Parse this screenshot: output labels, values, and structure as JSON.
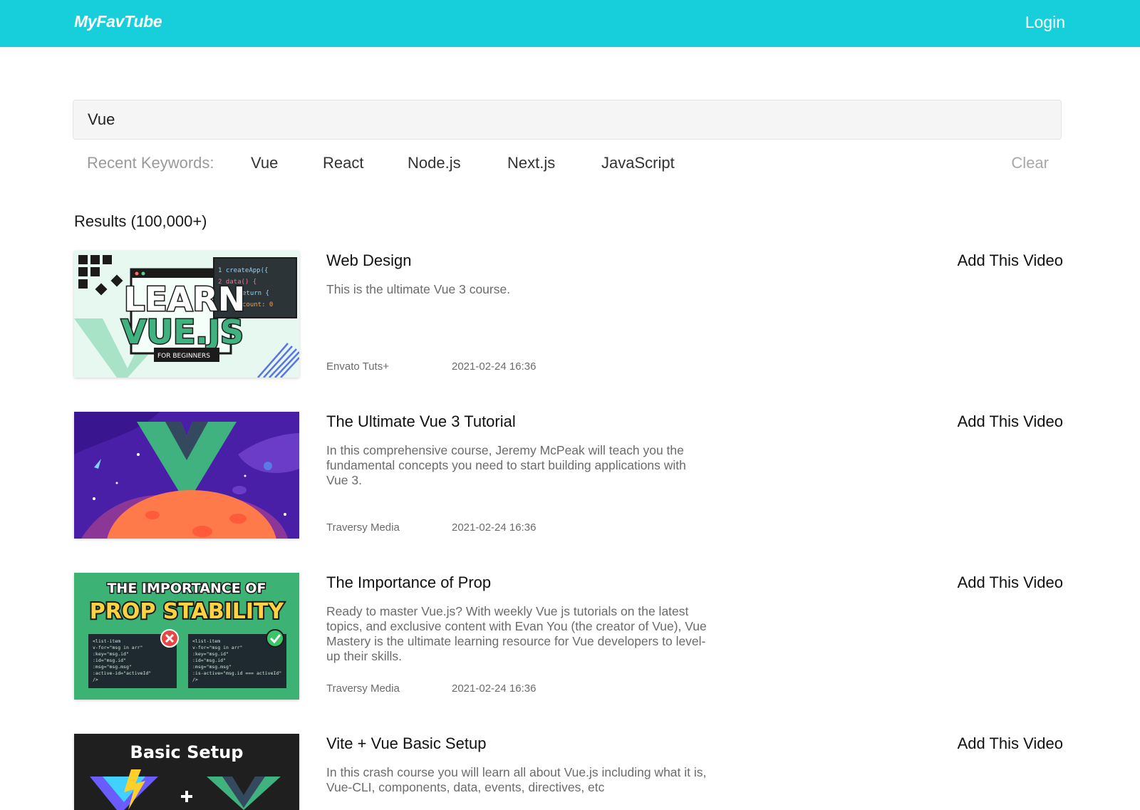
{
  "header": {
    "logo": "MyFavTube",
    "login_label": "Login",
    "bg_color": "#17cfdb"
  },
  "search": {
    "value": "Vue"
  },
  "recent": {
    "label": "Recent Keywords:",
    "keywords": [
      "Vue",
      "React",
      "Node.js",
      "Next.js",
      "JavaScript"
    ],
    "clear_label": "Clear"
  },
  "results": {
    "title": "Results (100,000+)",
    "add_label": "Add This Video",
    "items": [
      {
        "title": "Web Design",
        "description": "This is the ultimate Vue 3 course.",
        "channel": "Envato Tuts+",
        "date": "2021-02-24 16:36",
        "thumb": {
          "line1": "LEARN",
          "line2": "VUE.JS",
          "caption": "FOR BEGINNERS",
          "code1": "1 createApp({",
          "code2": "2   data() {",
          "code3": "   eturn {",
          "code4": "     count: 0"
        }
      },
      {
        "title": "The Ultimate Vue 3 Tutorial",
        "description": "In this comprehensive course, Jeremy McPeak will teach you the fundamental concepts you need to start building applications with Vue 3.",
        "channel": "Traversy Media",
        "date": "2021-02-24 16:36"
      },
      {
        "title": "The Importance of Prop",
        "description": "Ready to master Vue.js? With weekly Vue js tutorials on the latest topics, and exclusive content with Evan You (the creator of Vue), Vue Mastery is the ultimate learning resource for Vue developers to level-up their skills.",
        "channel": "Traversy Media",
        "date": "2021-02-24 16:36",
        "thumb": {
          "line1": "THE IMPORTANCE OF",
          "line2": "PROP STABILITY",
          "code_left": [
            "<list-item",
            "  v-for=\"msg in arr\"",
            "  :key=\"msg.id\"",
            "  :id=\"msg.id\"",
            "  :msg=\"msg.msg\"",
            "  :active-id=\"activeId\"",
            "/>"
          ],
          "code_right": [
            "<list-item",
            "  v-for=\"msg in arr\"",
            "  :key=\"msg.id\"",
            "  :id=\"msg.id\"",
            "  :msg=\"msg.msg\"",
            "  :is-active=\"msg.id === activeId\"",
            "/>"
          ]
        }
      },
      {
        "title": "Vite + Vue Basic Setup",
        "description": "In this crash course you will learn all about Vue.js including what it is, Vue-CLI, components, data, events, directives, etc",
        "channel": "",
        "date": "",
        "thumb": {
          "line1": "Basic Setup"
        }
      }
    ]
  }
}
